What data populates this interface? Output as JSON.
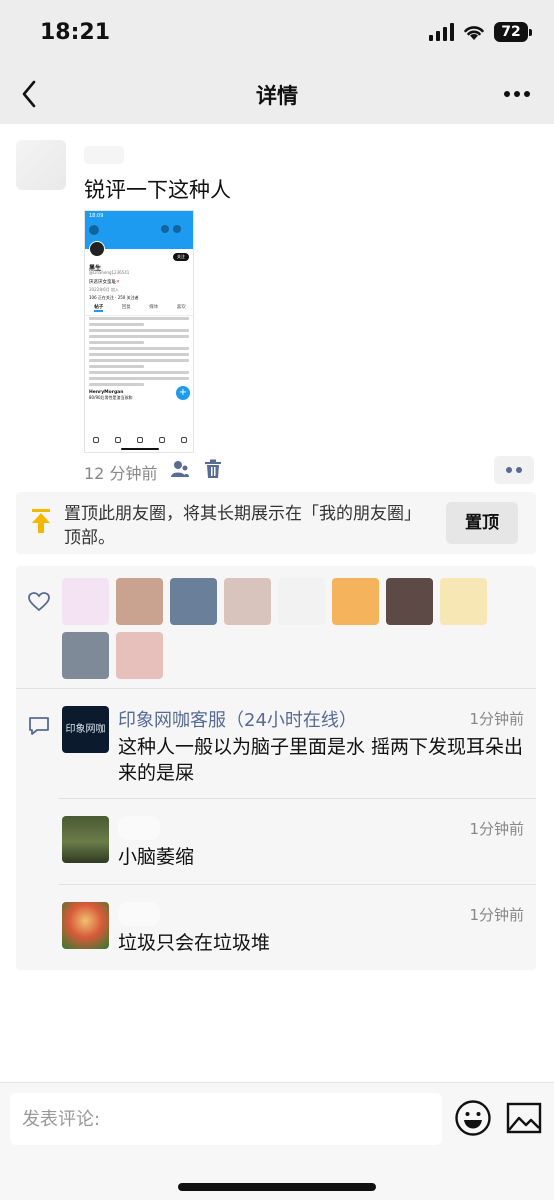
{
  "status_bar": {
    "time": "18:21",
    "battery": "72"
  },
  "nav": {
    "title": "详情"
  },
  "post": {
    "text": "锐评一下这种人",
    "time": "12 分钟前",
    "screenshot": {
      "time": "18:09",
      "follow": "关注",
      "name": "黑生",
      "handle": "@LinSheng1236541",
      "bio": "厌恶厌女蛮耻",
      "bio_mark": "✕",
      "meta": "2022年6月 加入",
      "follows": "106 正在关注 · 250 关注者",
      "tabs": [
        "帖子",
        "回复",
        "媒体",
        "喜欢"
      ],
      "reply_user": "HenryMorgan",
      "reply_text": "80/90后男性是渣当孩和",
      "fab": "+"
    }
  },
  "pin": {
    "text": "置顶此朋友圈，将其长期展示在「我的朋友圈」顶部。",
    "button": "置顶"
  },
  "likers": [
    {
      "icon": "unicorn-avatar",
      "color": "#f3e3f3"
    },
    {
      "icon": "phone-photo-avatar",
      "color": "#c9a38f"
    },
    {
      "icon": "hands-avatar",
      "color": "#6a7f99"
    },
    {
      "icon": "girl-avatar",
      "color": "#d9c4bd"
    },
    {
      "icon": "sketch-avatar",
      "color": "#f2f2f2"
    },
    {
      "icon": "anime-avatar",
      "color": "#f5b45b"
    },
    {
      "icon": "sleeping-avatar",
      "color": "#5d4a46"
    },
    {
      "icon": "cat-avatar",
      "color": "#f7e7b4"
    },
    {
      "icon": "sunset-avatar",
      "color": "#7e8a98"
    },
    {
      "icon": "girl2-avatar",
      "color": "#e8c0bb"
    }
  ],
  "comments": [
    {
      "name": "印象网咖客服（24小时在线）",
      "avatar_text": "印象网咖",
      "avatar_color": "#0c1a2e",
      "time": "1分钟前",
      "text": "这种人一般以为脑子里面是水 摇两下发现耳朵出来的是屎"
    },
    {
      "name": "",
      "avatar_color": "#5a6a3d",
      "time": "1分钟前",
      "text": "小脑萎缩"
    },
    {
      "name": "",
      "avatar_color": "#c23a24",
      "time": "1分钟前",
      "text": "垃圾只会在垃圾堆"
    }
  ],
  "input": {
    "placeholder": "发表评论:"
  }
}
